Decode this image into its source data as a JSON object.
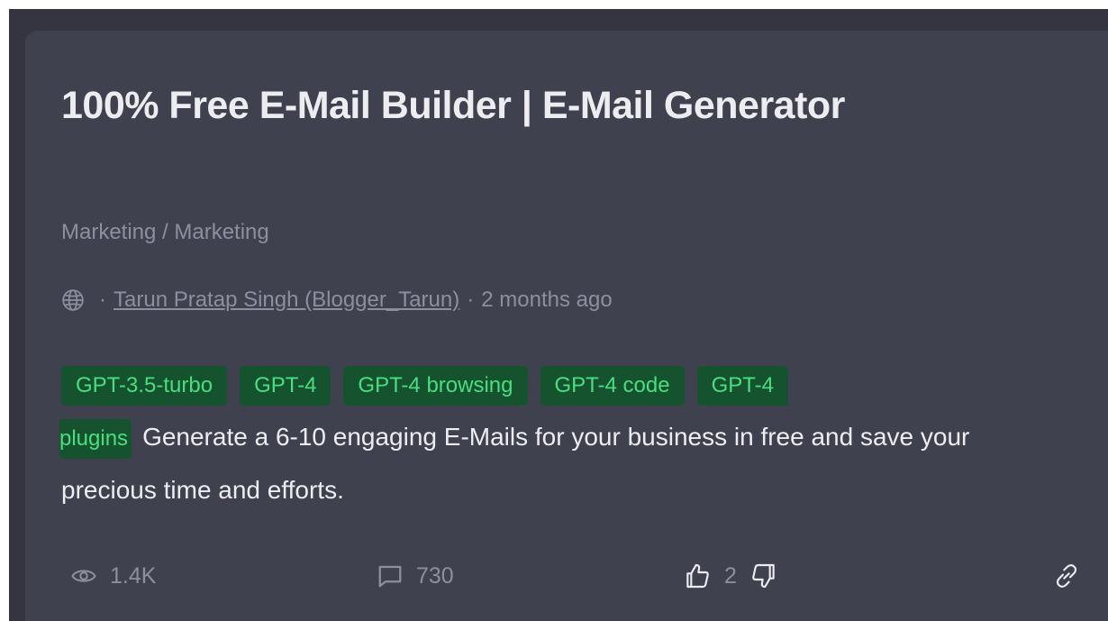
{
  "card": {
    "title": "100% Free E-Mail Builder | E-Mail Generator",
    "category": "Marketing / Marketing",
    "meta": {
      "separator1": "·",
      "author": "Tarun Pratap Singh (Blogger_Tarun)",
      "separator2": "·",
      "time": "2 months ago"
    },
    "tags": [
      "GPT-3.5-turbo",
      "GPT-4",
      "GPT-4 browsing",
      "GPT-4 code",
      "GPT-4",
      "plugins"
    ],
    "description": "Generate a 6-10 engaging E-Mails for your business in free and save your precious time and efforts.",
    "stats": {
      "views": "1.4K",
      "comments": "730",
      "likes": "2"
    },
    "icons": {
      "globe": "globe-icon",
      "views": "eye-icon",
      "comments": "comment-icon",
      "like": "thumbs-up-icon",
      "dislike": "thumbs-down-icon",
      "link": "link-icon"
    },
    "colors": {
      "page_bg": "#343541",
      "card_bg": "#40414f",
      "tag_bg": "#14532d",
      "tag_text": "#4ade80",
      "muted_text": "#8e8ea0",
      "main_text": "#ececf1"
    }
  }
}
